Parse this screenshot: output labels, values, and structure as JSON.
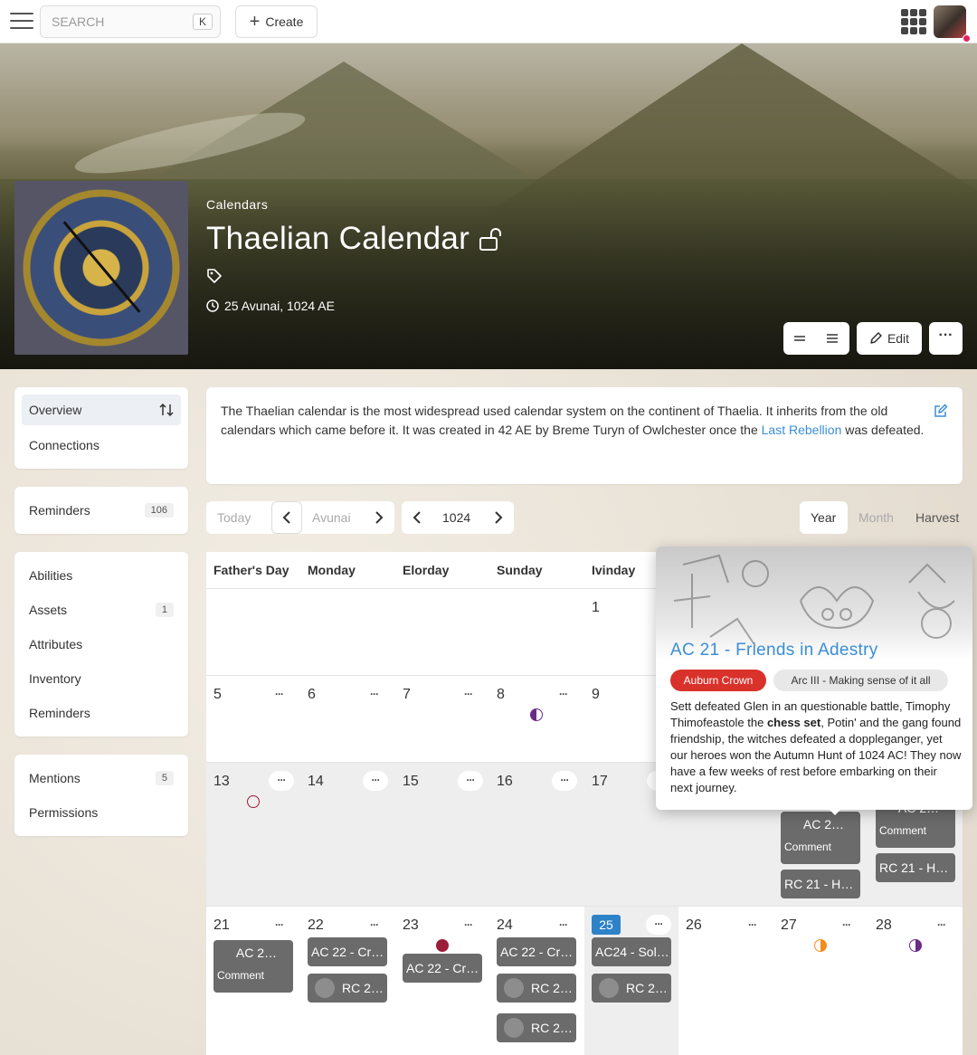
{
  "topbar": {
    "search_placeholder": "SEARCH",
    "search_shortcut": "K",
    "create_label": "Create"
  },
  "hero": {
    "breadcrumb": "Calendars",
    "title": "Thaelian Calendar",
    "date": "25 Avunai, 1024 AE",
    "edit_label": "Edit",
    "more_label": "···"
  },
  "sidebar": {
    "group1": [
      {
        "label": "Overview"
      },
      {
        "label": "Connections"
      }
    ],
    "group2": [
      {
        "label": "Reminders",
        "count": "106"
      }
    ],
    "group3": [
      {
        "label": "Abilities"
      },
      {
        "label": "Assets",
        "count": "1"
      },
      {
        "label": "Attributes"
      },
      {
        "label": "Inventory"
      },
      {
        "label": "Reminders"
      }
    ],
    "group4": [
      {
        "label": "Mentions",
        "count": "5"
      },
      {
        "label": "Permissions"
      }
    ]
  },
  "description": {
    "text_before": "The Thaelian calendar is the most widespread used calendar system on the continent of Thaelia. It inherits from the old calendars which came before it. It was created in 42 AE by Breme Turyn of Owlchester once the ",
    "link": "Last Rebellion",
    "text_after": " was defeated."
  },
  "calendar_nav": {
    "today": "Today",
    "month": "Avunai",
    "year": "1024",
    "view_year": "Year",
    "view_month": "Month",
    "view_harvest": "Harvest"
  },
  "calendar": {
    "weekdays": [
      "Father's Day",
      "Monday",
      "Elorday",
      "Sunday",
      "Ivinday"
    ],
    "dots": "···",
    "days": {
      "d1": "1",
      "d5": "5",
      "d6": "6",
      "d7": "7",
      "d8": "8",
      "d9": "9",
      "d13": "13",
      "d14": "14",
      "d15": "15",
      "d16": "16",
      "d17": "17",
      "d21": "21",
      "d22": "22",
      "d23": "23",
      "d24": "24",
      "d25": "25",
      "d26": "26",
      "d27": "27",
      "d28": "28"
    },
    "entries": {
      "e_w3_c6_1": "AC 2…",
      "e_w3_c6_1_sub": "Comment",
      "e_w3_c6_2": "RC 21 - Ho…",
      "e_w3_c7_1": "AC 2…",
      "e_w3_c7_1_sub": "Comment",
      "e_w3_c7_2": "RC 21 - Ho…",
      "e_21_1": "AC 2…",
      "e_21_1_sub": "Comment",
      "e_22_1": "AC 22 - Cr…",
      "e_22_2": "RC 2…",
      "e_23_1": "AC 22 - Cr…",
      "e_24_1": "AC 22 - Cr…",
      "e_24_2": "RC 2…",
      "e_24_3": "RC 2…",
      "e_25_1": "AC24 - Sol…",
      "e_25_2": "RC 2…"
    },
    "moon_colors": {
      "crimson": "#9b1d3a",
      "orange": "#f28c1c",
      "purple": "#6b2a8a"
    }
  },
  "popover": {
    "title": "AC 21 - Friends in Adestry",
    "tag1": "Auburn Crown",
    "tag1_color": "#d9322b",
    "tag2": "Arc III - Making sense of it all",
    "text_before": "Sett defeated Glen in an questionable battle, Timophy Thimofeastole the ",
    "text_bold": "chess set",
    "text_after": ", Potin' and the gang found friendship, the witches defeated a doppleganger, yet our heroes won the Autumn Hunt of 1024 AC! They now have a few weeks of rest before embarking on their next journey."
  }
}
